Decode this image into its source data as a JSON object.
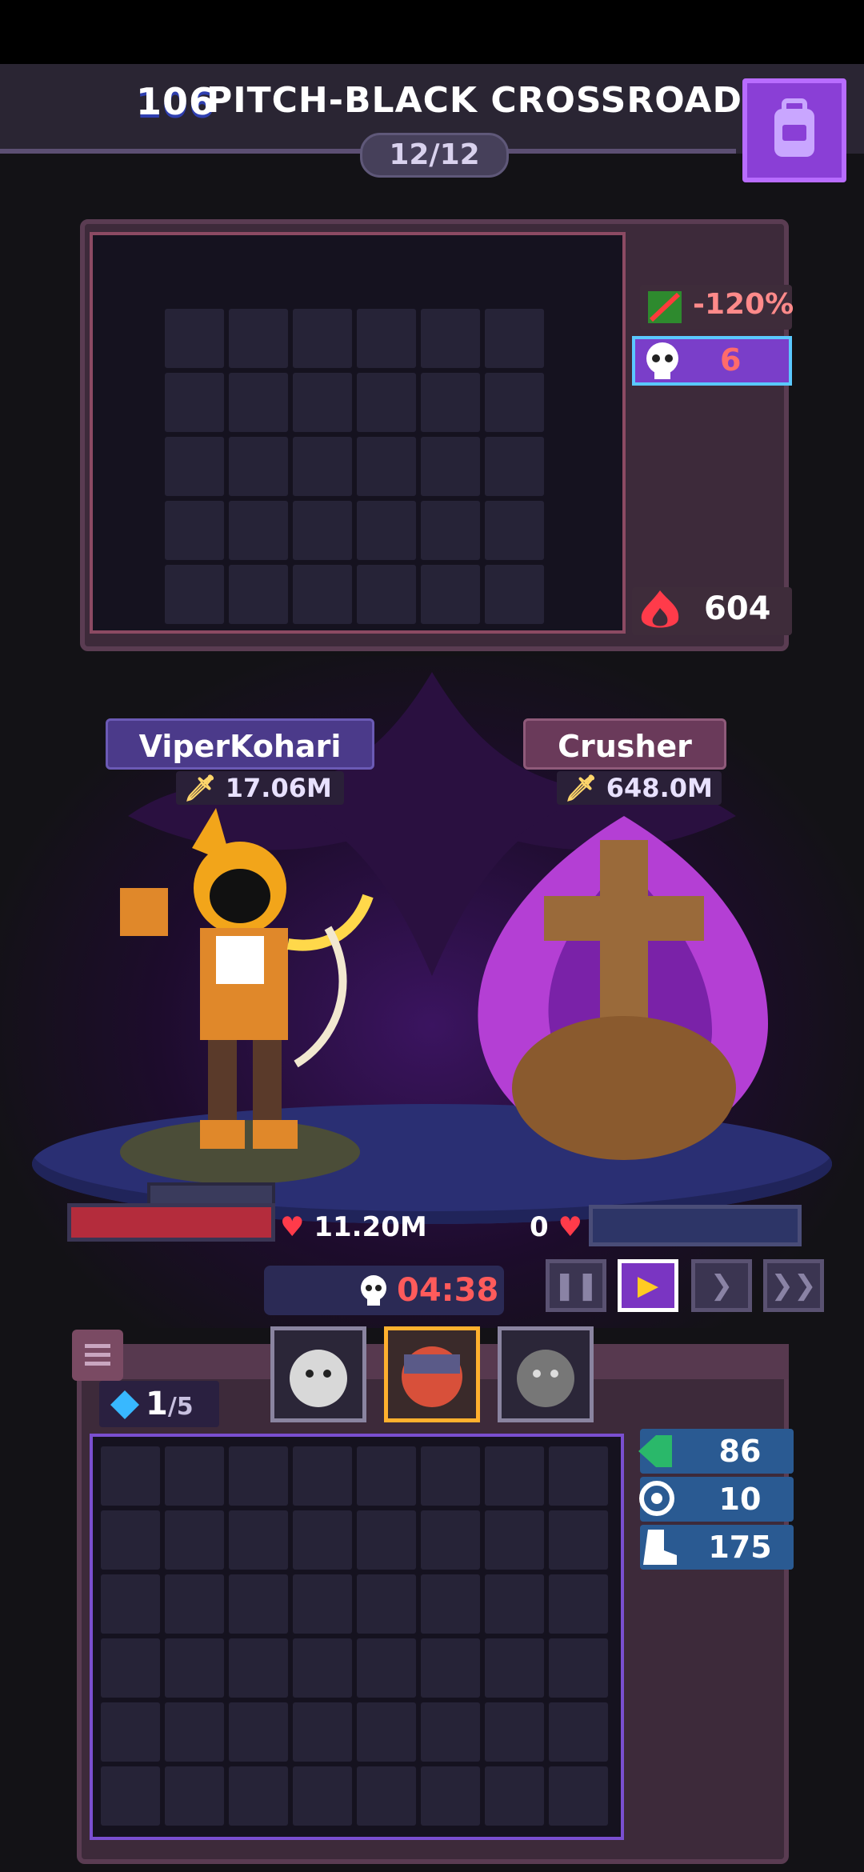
{
  "header": {
    "stage_number": "106",
    "stage_name": "PITCH-BLACK CROSSROADS",
    "wave": "12/12"
  },
  "enemy_inventory": {
    "damage_reduction": "-120%",
    "skull_stacks": "6",
    "burn_value": "604"
  },
  "player": {
    "name": "ViperKohari",
    "power": "17.06M",
    "hp": "11.20M"
  },
  "enemy": {
    "name": "Crusher",
    "power": "648.0M",
    "hp": "0"
  },
  "controls": {
    "timer": "04:38",
    "pause_glyph": "❚❚",
    "play_glyph": "▶",
    "fast_glyph": "❯",
    "faster_glyph": "❯❯"
  },
  "player_inventory": {
    "gems": "1",
    "gems_max": "/5",
    "stat_1": "86",
    "stat_2": "10",
    "stat_3": "175"
  },
  "colors": {
    "accent_purple": "#8a3fd6",
    "hp_red": "#b42c3c",
    "timer_red": "#ff5b5b",
    "stat_blue": "#2a5a92"
  }
}
